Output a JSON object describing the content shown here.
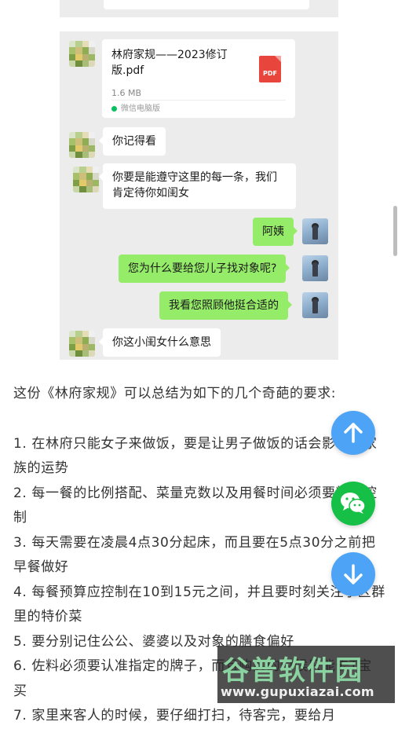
{
  "chat": {
    "file": {
      "name": "林府家规——2023修订版.pdf",
      "size": "1.6 MB",
      "source": "微信电脑版",
      "icon_label": "PDF",
      "icon": "pdf-file-icon"
    },
    "messages": [
      {
        "side": "left",
        "text": "你记得看"
      },
      {
        "side": "left",
        "text": "你要是能遵守这里的每一条，我们\n肯定待你如闺女"
      },
      {
        "side": "right",
        "text": "阿姨"
      },
      {
        "side": "right",
        "text": "您为什么要给您儿子找对象呢?"
      },
      {
        "side": "right",
        "text": "我看您照顾他挺合适的"
      },
      {
        "side": "left",
        "text": "你这小闺女什么意思"
      }
    ],
    "colors": {
      "bubble_mine": "#95ec69",
      "bubble_other": "#ffffff",
      "background": "#ececec"
    }
  },
  "article": {
    "intro": "这份《林府家规》可以总结为如下的几个奇葩的要求:",
    "items": [
      "1. 在林府只能女子来做饭，要是让男子做饭的话会影响到家族的运势",
      "2. 每一餐的比例搭配、菜量克数以及用餐时间必须要精准控制",
      "3. 每天需要在凌晨4点30分起床，而且要在5点30分之前把早餐做好",
      "4. 每餐预算应控制在10到15元之间，并且要时刻关注小区群里的特价菜",
      "5. 要分别记住公公、婆婆以及对象的膳食偏好",
      "6. 佐料必须要认准指定的牌子，而且购买的时候只能去T宝买",
      "7. 家里来客人的时候，要仔细打扫，待客完，要给月"
    ]
  },
  "fabs": {
    "up": "arrow-up-icon",
    "wechat": "wechat-icon",
    "down": "arrow-down-icon",
    "colors": {
      "blue": "#4da3f5",
      "green": "#16c046"
    }
  },
  "watermark": {
    "title": "谷普软件园",
    "url": "www.gupuxiazai.com"
  }
}
